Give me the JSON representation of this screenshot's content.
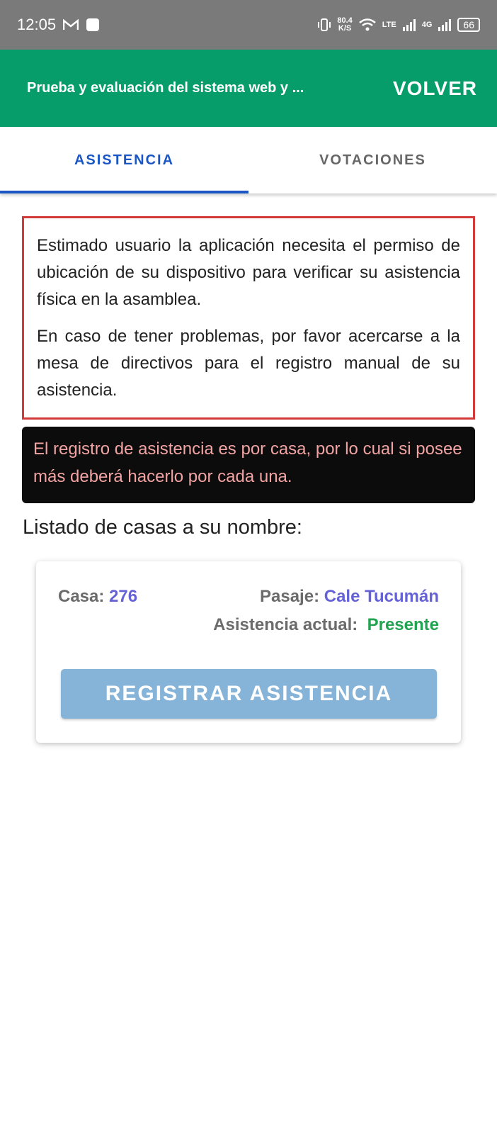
{
  "status_bar": {
    "time": "12:05",
    "netspeed_value": "80.4",
    "netspeed_unit": "K/S",
    "lte": "LTE",
    "network_4g": "4G",
    "battery": "66"
  },
  "app_bar": {
    "title": "Prueba y evaluación del sistema web y ...",
    "back_label": "VOLVER",
    "color": "#069d6b"
  },
  "tabs": [
    {
      "label": "ASISTENCIA",
      "active": true
    },
    {
      "label": "VOTACIONES",
      "active": false
    }
  ],
  "notice": {
    "paragraph1": "Estimado usuario la aplicación necesita el permiso de ubicación de su dispositivo para verificar su asistencia física en la asamblea.",
    "paragraph2": "En caso de tener problemas, por favor acercarse a la mesa de directivos para el registro manual de su asistencia."
  },
  "alert": {
    "text": "El registro de asistencia es por casa, por lo cual si posee más deberá hacerlo por cada una."
  },
  "list_title": "Listado de casas a su nombre:",
  "house": {
    "house_label": "Casa:",
    "house_number": "276",
    "street_label": "Pasaje:",
    "street_value": "Cale Tucumán",
    "attendance_label": "Asistencia actual:",
    "attendance_value": "Presente",
    "register_button": "REGISTRAR ASISTENCIA"
  }
}
